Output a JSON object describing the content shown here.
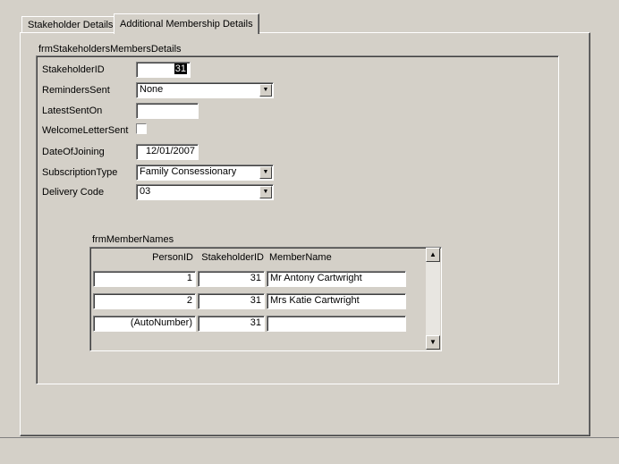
{
  "tabs": [
    {
      "label": "Stakeholder Details"
    },
    {
      "label": "Additional Membership Details"
    }
  ],
  "subform": {
    "caption": "frmStakeholdersMembersDetails",
    "fields": {
      "stakeholder_id": {
        "label": "StakeholderID",
        "value": "31"
      },
      "reminders_sent": {
        "label": "RemindersSent",
        "value": "None"
      },
      "latest_sent_on": {
        "label": "LatestSentOn",
        "value": ""
      },
      "welcome_letter_sent": {
        "label": "WelcomeLetterSent",
        "checked": false
      },
      "date_of_joining": {
        "label": "DateOfJoining",
        "value": "12/01/2007"
      },
      "subscription_type": {
        "label": "SubscriptionType",
        "value": "Family Consessionary"
      },
      "delivery_code": {
        "label": "Delivery Code",
        "value": "03"
      }
    }
  },
  "member_names": {
    "caption": "frmMemberNames",
    "columns": [
      "PersonID",
      "StakeholderID",
      "MemberName"
    ],
    "rows": [
      {
        "person_id": "1",
        "stakeholder_id": "31",
        "member_name": "Mr Antony Cartwright"
      },
      {
        "person_id": "2",
        "stakeholder_id": "31",
        "member_name": "Mrs Katie Cartwright"
      },
      {
        "person_id": "(AutoNumber)",
        "stakeholder_id": "31",
        "member_name": ""
      }
    ]
  },
  "icons": {
    "combo": "chevron-down-icon",
    "scroll_up": "arrow-up-icon",
    "scroll_down": "arrow-down-icon"
  }
}
